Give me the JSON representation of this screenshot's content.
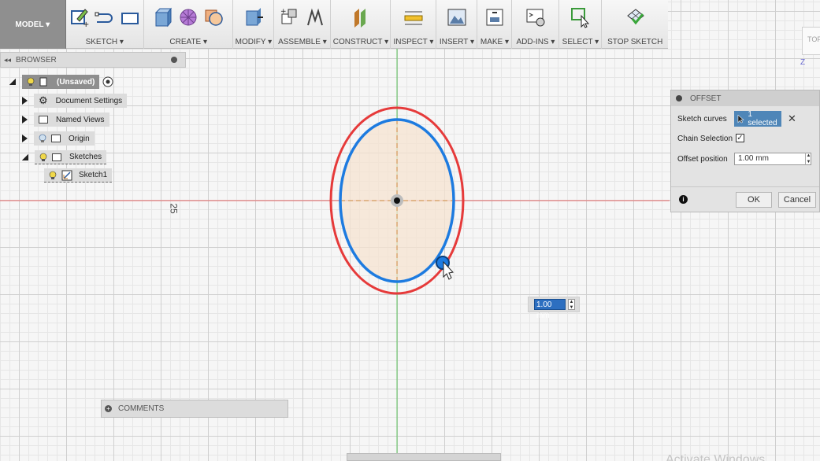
{
  "toolbar": {
    "model_label": "MODEL ▾",
    "groups": [
      {
        "label": "SKETCH ▾"
      },
      {
        "label": "CREATE ▾"
      },
      {
        "label": "MODIFY ▾"
      },
      {
        "label": "ASSEMBLE ▾"
      },
      {
        "label": "CONSTRUCT ▾"
      },
      {
        "label": "INSPECT ▾"
      },
      {
        "label": "INSERT ▾"
      },
      {
        "label": "MAKE ▾"
      },
      {
        "label": "ADD-INS ▾"
      },
      {
        "label": "SELECT ▾"
      },
      {
        "label": "STOP SKETCH"
      }
    ]
  },
  "browser": {
    "title": "BROWSER",
    "collapse_glyph": "◂◂",
    "items": [
      {
        "label": "(Unsaved)"
      },
      {
        "label": "Document Settings"
      },
      {
        "label": "Named Views"
      },
      {
        "label": "Origin"
      },
      {
        "label": "Sketches"
      },
      {
        "label": "Sketch1"
      }
    ]
  },
  "canvas": {
    "ruler_label": "25",
    "colors": {
      "outer_curve": "#e63a3a",
      "inner_curve": "#1d7be0",
      "fill": "#f5e3d0",
      "x_axis": "#e86a6a",
      "y_axis": "#5ec45e"
    }
  },
  "offset_panel": {
    "title": "OFFSET",
    "sketch_curves_label": "Sketch curves",
    "selection_value": "1 selected",
    "chain_selection_label": "Chain Selection",
    "chain_selection_checked": true,
    "offset_position_label": "Offset position",
    "offset_position_value": "1.00 mm",
    "ok_label": "OK",
    "cancel_label": "Cancel"
  },
  "float_input": {
    "value": "1.00 mm"
  },
  "comments": {
    "label": "COMMENTS"
  },
  "viewcube": {
    "face_label": "TOP",
    "axis_label": "Z"
  },
  "watermark": "Activate Windows"
}
